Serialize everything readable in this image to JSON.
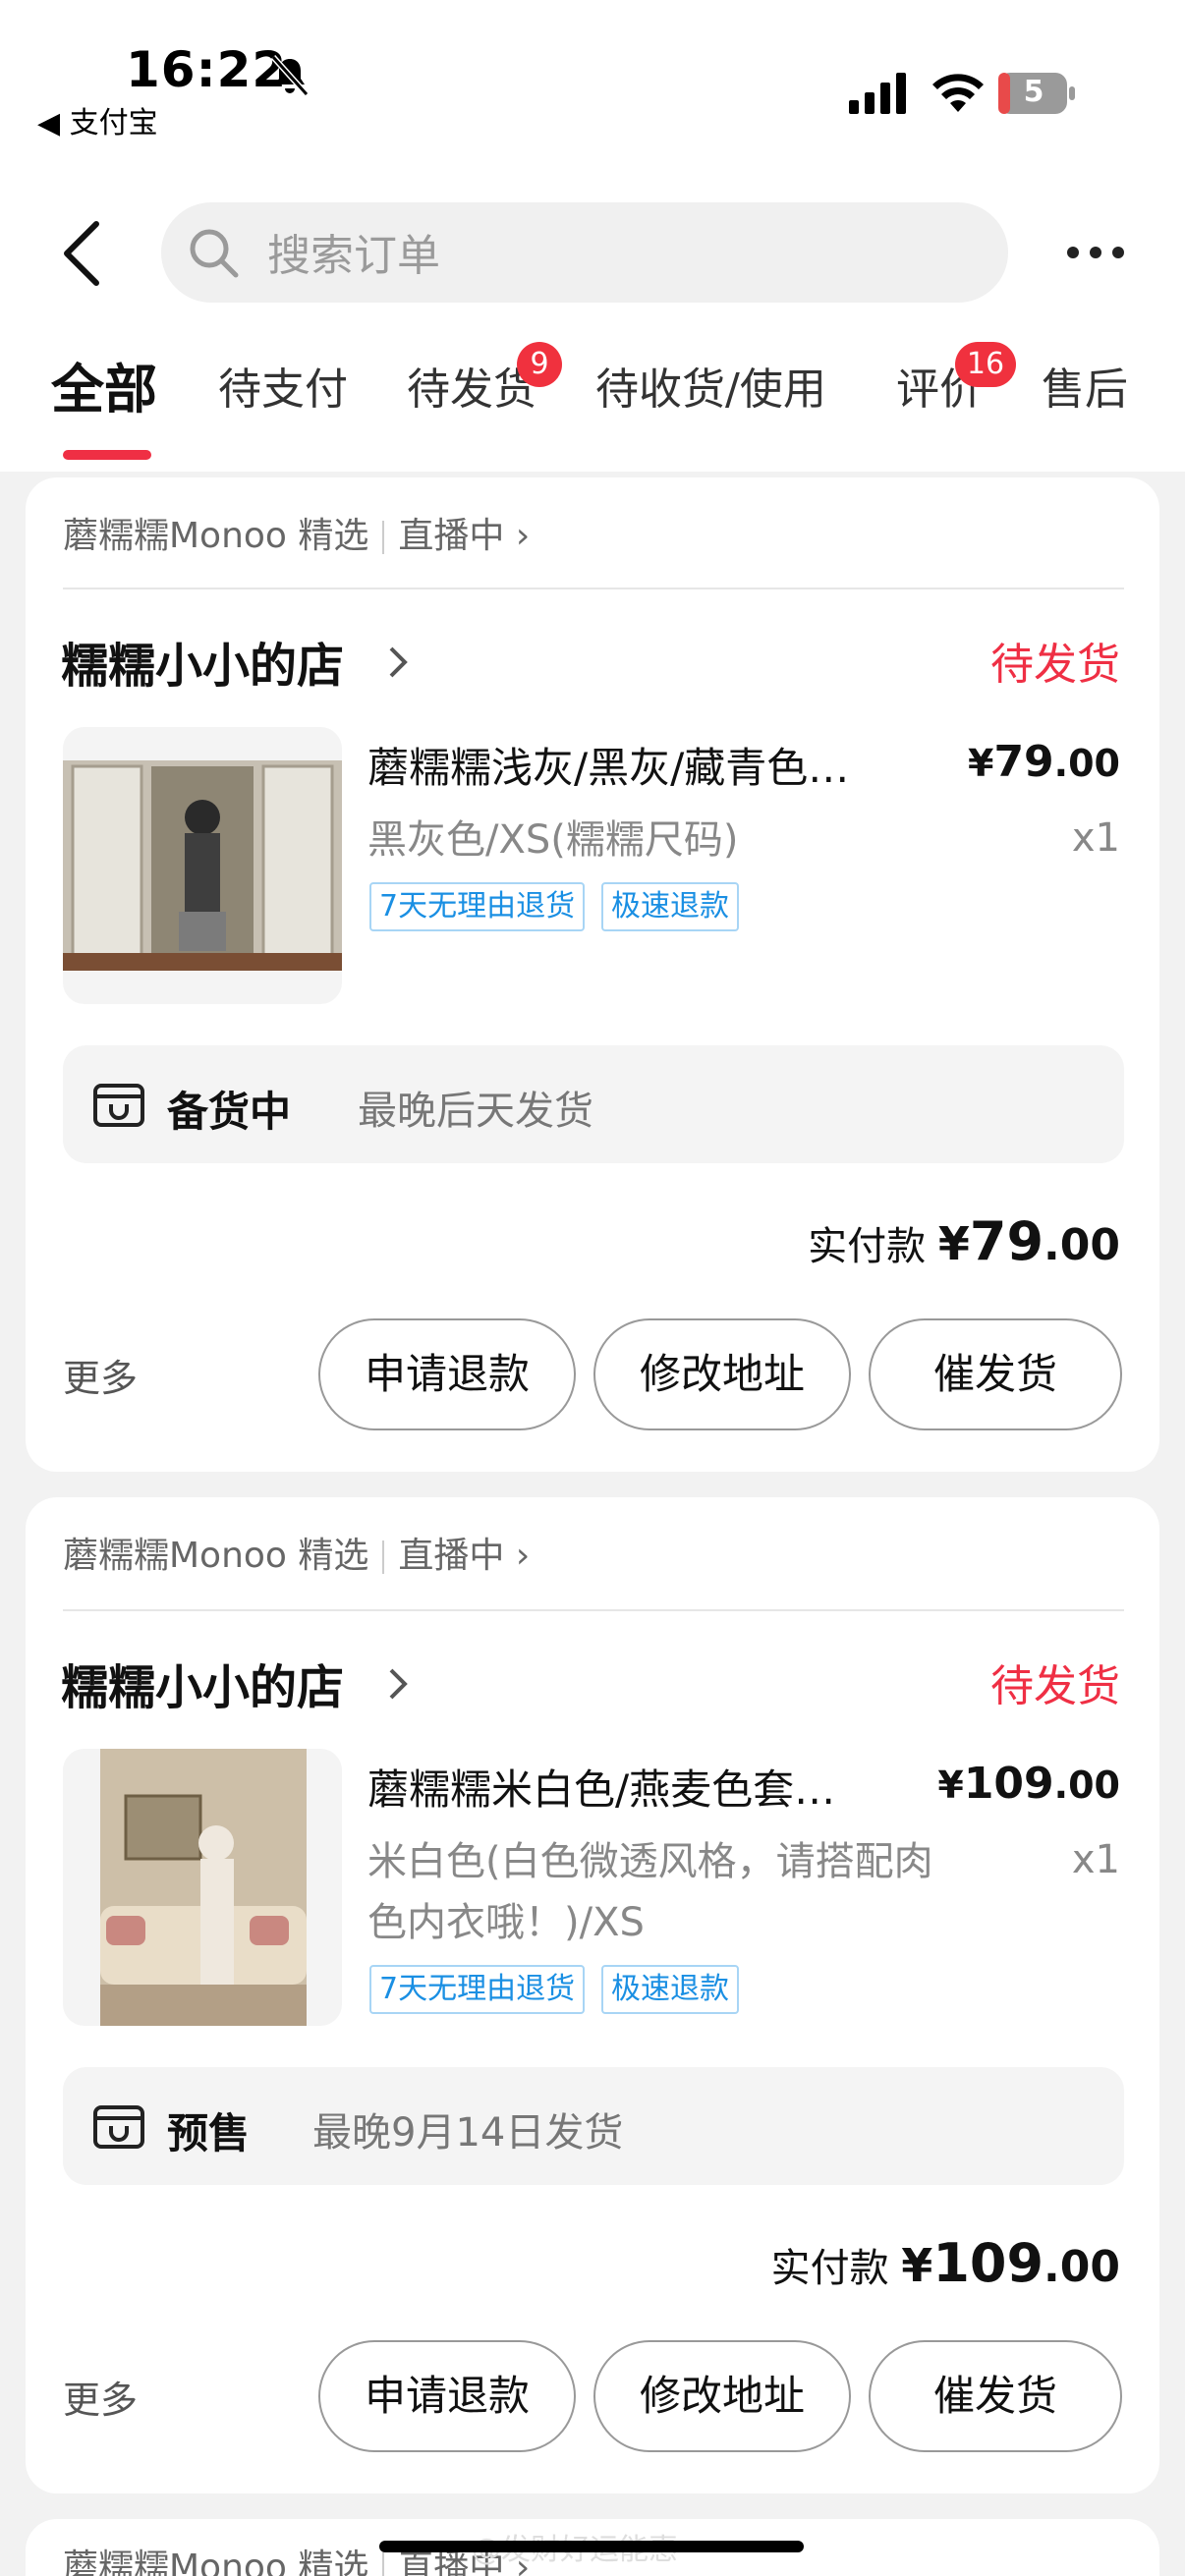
{
  "status_bar": {
    "time": "16:22",
    "back_app": "◀ 支付宝",
    "battery": "5"
  },
  "header": {
    "search_placeholder": "搜索订单",
    "tabs": [
      {
        "label": "全部",
        "active": true
      },
      {
        "label": "待支付"
      },
      {
        "label": "待发货",
        "badge": "9"
      },
      {
        "label": "待收货/使用"
      },
      {
        "label": "评价",
        "badge": "16"
      },
      {
        "label": "售后"
      }
    ]
  },
  "orders": [
    {
      "channel": "蘑糯糯Monoo 精选",
      "live": "直播中",
      "shop": "糯糯小小的店",
      "status": "待发货",
      "product_name": "蘑糯糯浅灰/黑灰/藏青色…",
      "price_symbol": "¥",
      "price_int": "79",
      "price_dec": ".00",
      "spec": "黑灰色/XS(糯糯尺码)",
      "qty": "x1",
      "tags": [
        "7天无理由退货",
        "极速退款"
      ],
      "ship_label": "备货中",
      "ship_note": "最晚后天发货",
      "paid_label": "实付款",
      "paid_symbol": "¥",
      "paid_int": "79",
      "paid_dec": ".00",
      "more": "更多",
      "buttons": [
        "申请退款",
        "修改地址",
        "催发货"
      ]
    },
    {
      "channel": "蘑糯糯Monoo 精选",
      "live": "直播中",
      "shop": "糯糯小小的店",
      "status": "待发货",
      "product_name": "蘑糯糯米白色/燕麦色套…",
      "price_symbol": "¥",
      "price_int": "109",
      "price_dec": ".00",
      "spec": "米白色(白色微透风格，请搭配肉色内衣哦！)/XS",
      "qty": "x1",
      "tags": [
        "7天无理由退货",
        "极速退款"
      ],
      "ship_label": "预售",
      "ship_note": "最晚9月14日发货",
      "paid_label": "实付款",
      "paid_symbol": "¥",
      "paid_int": "109",
      "paid_dec": ".00",
      "more": "更多",
      "buttons": [
        "申请退款",
        "修改地址",
        "催发货"
      ]
    },
    {
      "channel": "蘑糯糯Monoo 精选",
      "live": "直播中"
    }
  ],
  "watermark": "@发财好运能惠",
  "colors": {
    "accent": "#ef2f44",
    "tag_blue": "#1a8fe3"
  }
}
